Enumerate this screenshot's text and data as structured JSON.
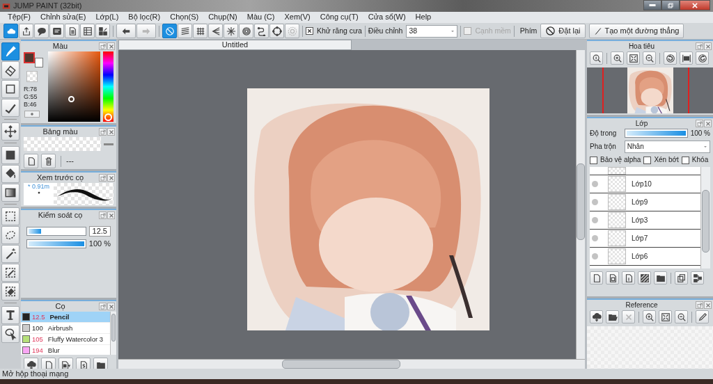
{
  "window": {
    "title": "JUMP PAINT (32bit)"
  },
  "menu": [
    "Tệp(F)",
    "Chỉnh sửa(E)",
    "Lớp(L)",
    "Bộ lọc(R)",
    "Chọn(S)",
    "Chụp(N)",
    "Màu (C)",
    "Xem(V)",
    "Công cụ(T)",
    "Cửa sổ(W)",
    "Help"
  ],
  "toolbar": {
    "file_buttons": [
      {
        "selected": true
      },
      {
        "selected": false
      },
      {
        "selected": false
      },
      {
        "selected": false
      },
      {
        "selected": false
      },
      {
        "selected": false
      },
      {
        "selected": false
      }
    ],
    "edit_buttons": [
      {
        "disabled": false
      },
      {
        "disabled": true
      }
    ],
    "ruler_buttons": [
      {
        "selected": true,
        "disabled": false
      },
      {
        "selected": false,
        "disabled": false
      },
      {
        "selected": false,
        "disabled": false
      },
      {
        "selected": false,
        "disabled": false
      },
      {
        "selected": false,
        "disabled": false
      },
      {
        "selected": false,
        "disabled": false
      },
      {
        "selected": false,
        "disabled": false
      },
      {
        "selected": false,
        "disabled": false
      },
      {
        "selected": false,
        "disabled": true
      }
    ],
    "antialias": {
      "label": "Khử răng cưa",
      "checked": true
    },
    "adjust": {
      "label": "Điều chỉnh",
      "value": "38"
    },
    "soft_edge": {
      "label": "Cạnh mềm",
      "checked": false,
      "disabled": true
    },
    "keys_label": "Phím",
    "reset_button": "Đặt lại",
    "line_button": "Tạo một đường thẳng"
  },
  "tools": [
    {
      "selected": true
    },
    {
      "selected": false
    },
    {
      "selected": false
    },
    {
      "selected": false
    },
    {
      "selected": false
    },
    {
      "selected": false
    },
    {
      "selected": false
    },
    {
      "selected": false
    },
    {
      "selected": false
    },
    {
      "selected": false
    },
    {
      "selected": false
    },
    {
      "selected": false
    },
    {
      "selected": false
    },
    {
      "selected": false
    },
    {
      "selected": false
    }
  ],
  "color_panel": {
    "title": "Màu",
    "r": "R:78",
    "g": "G:55",
    "b": "B:46"
  },
  "palette_panel": {
    "title": "Bảng màu",
    "label": "---"
  },
  "preview_panel": {
    "title": "Xem trước cọ",
    "size": "* 0.91m"
  },
  "brush_control": {
    "title": "Kiểm soát cọ",
    "size_slider": {
      "level": 0.22
    },
    "size": "12.5",
    "opacity_slider": {
      "level": 1
    },
    "opacity": "100 %"
  },
  "brushes_panel": {
    "title": "Cọ",
    "items": [
      {
        "size": "12.5",
        "name": "Pencil",
        "color": "#222222",
        "marked": true,
        "selected": true
      },
      {
        "size": "100",
        "name": "Airbrush",
        "color": "#cccccc",
        "marked": false,
        "selected": false
      },
      {
        "size": "105",
        "name": "Fluffy Watercolor 3",
        "color": "#b6e07a",
        "marked": true,
        "selected": false
      },
      {
        "size": "194",
        "name": "Blur",
        "color": "#f9a6f4",
        "marked": true,
        "selected": false
      }
    ]
  },
  "canvas": {
    "tab": "Untitled"
  },
  "navigator": {
    "title": "Hoa tiêu"
  },
  "layers_panel": {
    "title": "Lớp",
    "opacity_label": "Độ trong",
    "opacity_slider": {
      "level": 1
    },
    "opacity": "100 %",
    "blend_label": "Pha trộn",
    "blend": "Nhân",
    "options": [
      {
        "label": "Bảo vệ alpha",
        "checked": false
      },
      {
        "label": "Xén bớt",
        "checked": false
      },
      {
        "label": "Khóa",
        "checked": false
      }
    ],
    "layers": [
      {
        "name": "Lớp10"
      },
      {
        "name": "Lớp9"
      },
      {
        "name": "Lớp3"
      },
      {
        "name": "Lớp7"
      },
      {
        "name": "Lớp6"
      }
    ]
  },
  "reference_panel": {
    "title": "Reference"
  },
  "status_bar": "Mở hộp thoại mạng"
}
